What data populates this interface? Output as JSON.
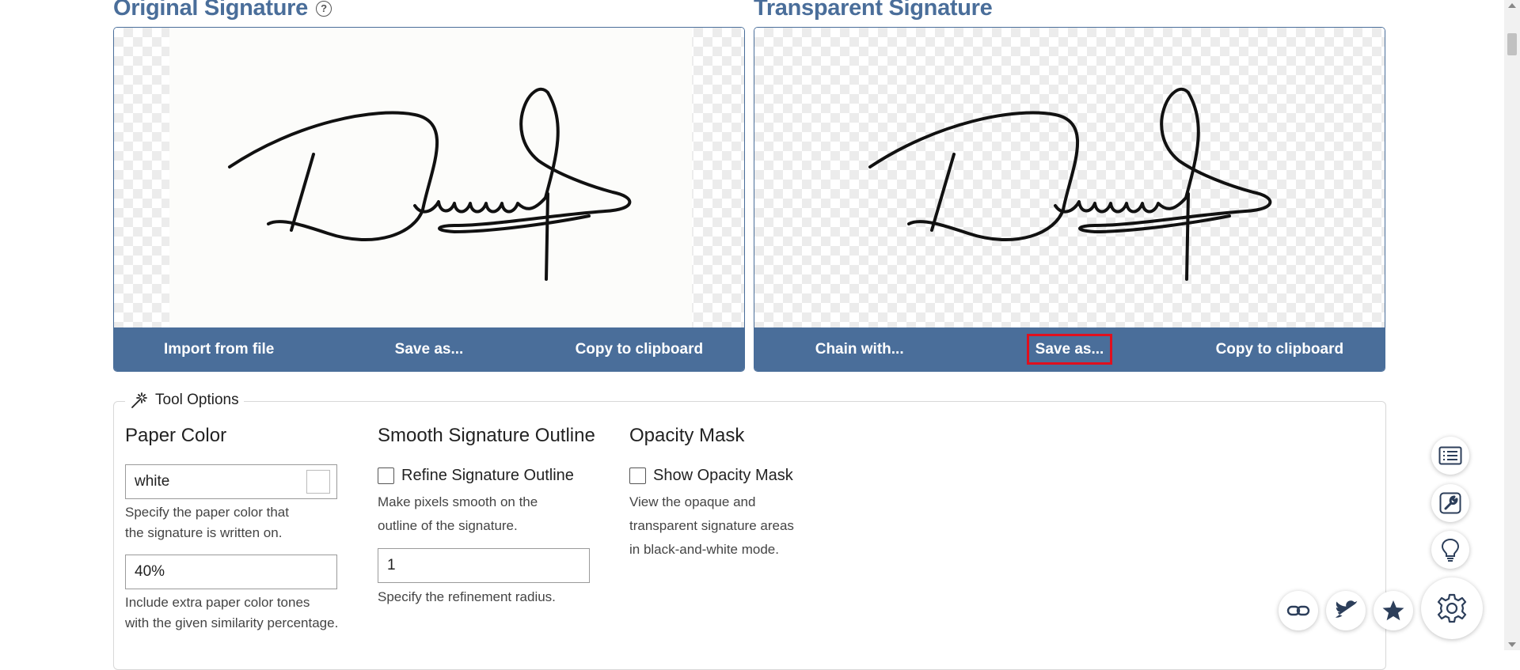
{
  "original": {
    "title": "Original Signature",
    "help_symbol": "?",
    "buttons": [
      "Import from file",
      "Save as...",
      "Copy to clipboard"
    ]
  },
  "transparent": {
    "title": "Transparent Signature",
    "buttons": [
      "Chain with...",
      "Save as...",
      "Copy to clipboard"
    ]
  },
  "tool_options": {
    "legend": "Tool Options",
    "paper_color": {
      "heading": "Paper Color",
      "value": "white",
      "hint": [
        "Specify the paper color that",
        "the signature is written on."
      ],
      "similarity_value": "40%",
      "similarity_hint": [
        "Include extra paper color tones",
        "with the given similarity percentage."
      ]
    },
    "smooth": {
      "heading": "Smooth Signature Outline",
      "checkbox_label": "Refine Signature Outline",
      "hint": [
        "Make pixels smooth on the",
        "outline of the signature."
      ],
      "radius_value": "1",
      "radius_hint": "Specify the refinement radius."
    },
    "opacity": {
      "heading": "Opacity Mask",
      "checkbox_label": "Show Opacity Mask",
      "hint": [
        "View the opaque and",
        "transparent signature areas",
        "in black-and-white mode."
      ]
    }
  },
  "colors": {
    "accent": "#4a6e9a",
    "highlight": "#e0101e"
  },
  "side_icons": [
    "list-icon",
    "wrench-icon",
    "lightbulb-icon",
    "gear-icon"
  ],
  "share_icons": [
    "link-icon",
    "twitter-icon",
    "star-icon"
  ]
}
